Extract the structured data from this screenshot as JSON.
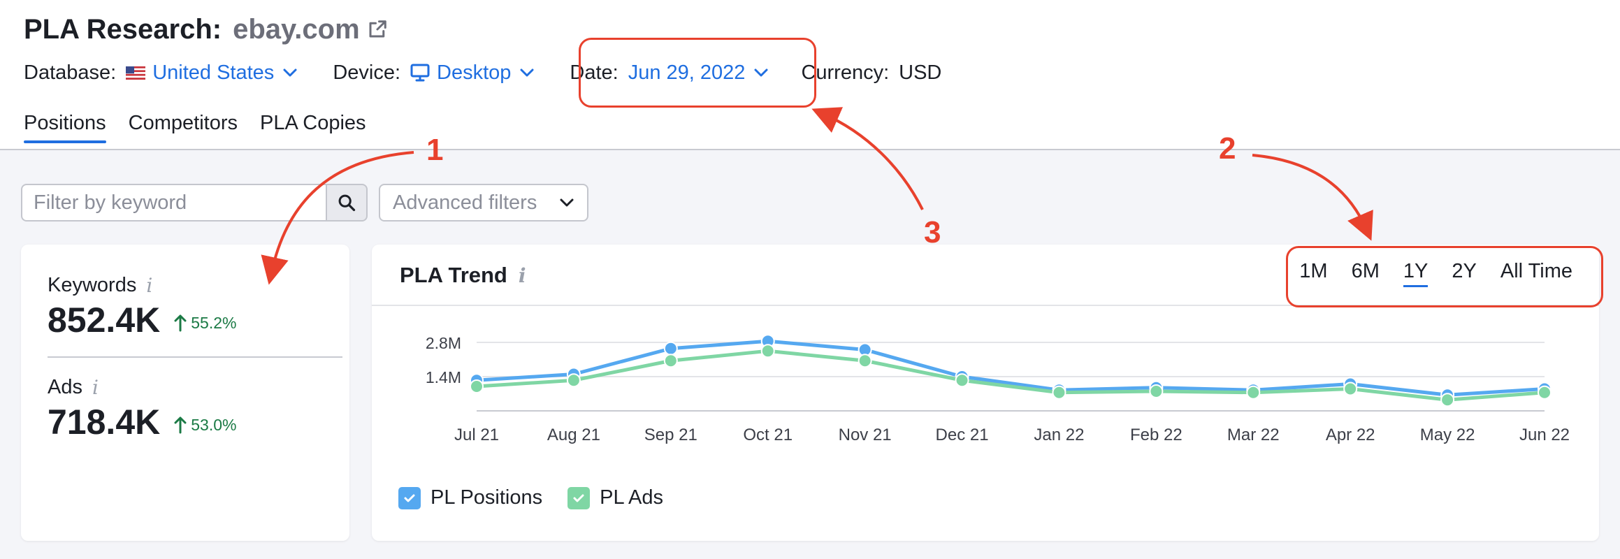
{
  "header": {
    "title": "PLA Research:",
    "domain": "ebay.com",
    "database_label": "Database:",
    "database_value": "United States",
    "device_label": "Device:",
    "device_value": "Desktop",
    "date_label": "Date:",
    "date_value": "Jun 29, 2022",
    "currency_label": "Currency:",
    "currency_value": "USD"
  },
  "tabs": [
    {
      "label": "Positions",
      "active": true
    },
    {
      "label": "Competitors",
      "active": false
    },
    {
      "label": "PLA Copies",
      "active": false
    }
  ],
  "filters": {
    "keyword_placeholder": "Filter by keyword",
    "advanced_label": "Advanced filters"
  },
  "stats": {
    "keywords": {
      "label": "Keywords",
      "value": "852.4K",
      "delta": "55.2%"
    },
    "ads": {
      "label": "Ads",
      "value": "718.4K",
      "delta": "53.0%"
    }
  },
  "trend": {
    "title": "PLA Trend",
    "ranges": [
      {
        "label": "1M",
        "active": false
      },
      {
        "label": "6M",
        "active": false
      },
      {
        "label": "1Y",
        "active": true
      },
      {
        "label": "2Y",
        "active": false
      },
      {
        "label": "All Time",
        "active": false
      }
    ],
    "legend": [
      {
        "label": "PL Positions",
        "color": "#55a8f0"
      },
      {
        "label": "PL Ads",
        "color": "#7fd6a4"
      }
    ]
  },
  "chart_data": {
    "type": "line",
    "x": [
      "Jul 21",
      "Aug 21",
      "Sep 21",
      "Oct 21",
      "Nov 21",
      "Dec 21",
      "Jan 22",
      "Feb 22",
      "Mar 22",
      "Apr 22",
      "May 22",
      "Jun 22"
    ],
    "y_ticks": [
      "2.8M",
      "1.4M"
    ],
    "ylim": [
      0,
      2800000
    ],
    "grid": true,
    "series": [
      {
        "name": "PL Positions",
        "color": "#55a8f0",
        "values": [
          1250000,
          1500000,
          2550000,
          2850000,
          2500000,
          1400000,
          850000,
          950000,
          850000,
          1100000,
          650000,
          900000
        ]
      },
      {
        "name": "PL Ads",
        "color": "#7fd6a4",
        "values": [
          1000000,
          1250000,
          2050000,
          2450000,
          2050000,
          1250000,
          750000,
          800000,
          750000,
          900000,
          450000,
          750000
        ]
      }
    ]
  },
  "annotations": {
    "one": "1",
    "two": "2",
    "three": "3",
    "color": "#e8412d"
  }
}
